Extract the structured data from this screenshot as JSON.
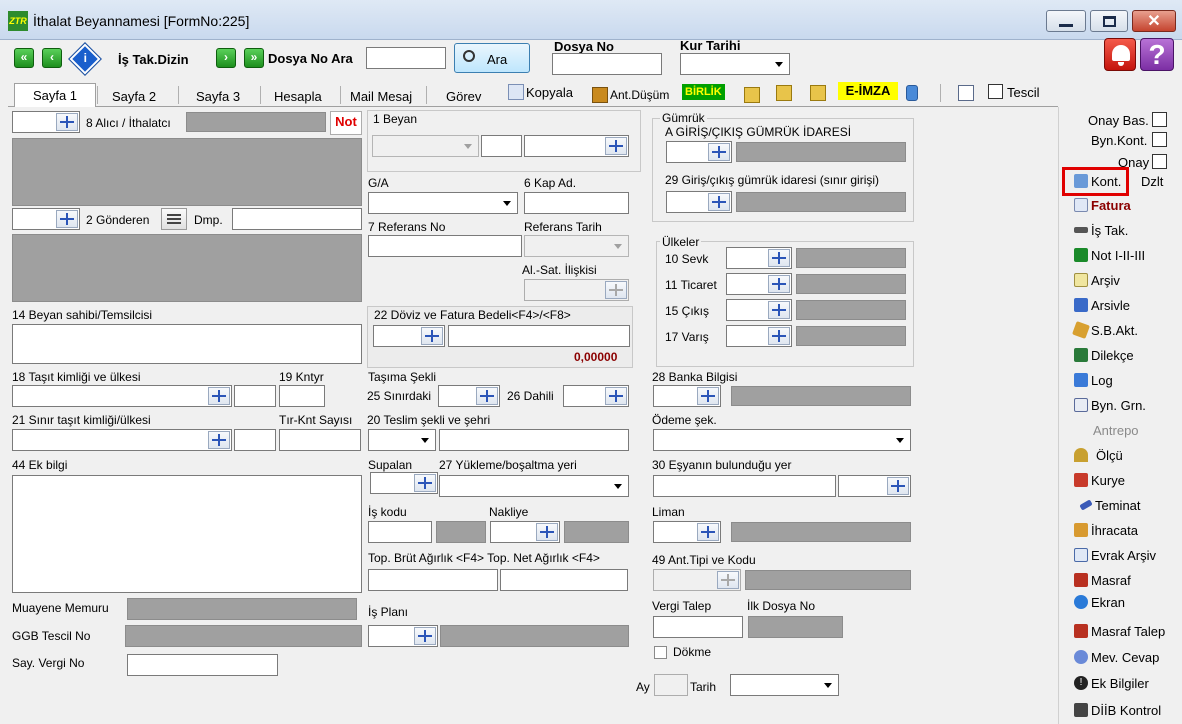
{
  "window": {
    "title": "İthalat Beyannamesi [FormNo:225]",
    "app_icon_text": "ZTR"
  },
  "toolbar": {
    "is_tak_dizin": "İş Tak.Dizin",
    "dosya_no_ara": "Dosya No Ara",
    "ara_button": "Ara",
    "dosya_no_label": "Dosya No",
    "kur_tarihi_label": "Kur Tarihi",
    "help_glyph": "?"
  },
  "tabs": [
    {
      "label": "Sayfa 1"
    },
    {
      "label": "Sayfa 2"
    },
    {
      "label": "Sayfa 3"
    },
    {
      "label": "Hesapla"
    },
    {
      "label": "Mail Mesaj"
    },
    {
      "label": "Görev"
    }
  ],
  "tab_tools": {
    "kopyala": "Kopyala",
    "ant_dusum": "Ant.Düşüm",
    "birlik": "BİRLİK",
    "e_imza": "E-İMZA",
    "tescil": "Tescil"
  },
  "form": {
    "alici": "8 Alıcı / İthalatcı",
    "not_badge": "Not",
    "gonderen": "2 Gönderen",
    "dmp": "Dmp.",
    "beyan_sahibi": "14 Beyan sahibi/Temsilcisi",
    "tasit_kimligi": "18 Taşıt kimliği ve ülkesi",
    "kntyr": "19 Kntyr",
    "sinir_tasit": "21 Sınır taşıt kimliği/ülkesi",
    "tir_knt": "Tır-Knt Sayısı",
    "ek_bilgi": "44 Ek bilgi",
    "muayene": "Muayene Memuru",
    "ggb_tescil": "GGB Tescil No",
    "say_vergi": "Say. Vergi No",
    "beyan": "1 Beyan",
    "ga": "G/A",
    "kap_ad": "6 Kap Ad.",
    "referans_no": "7 Referans No",
    "referans_tarih": "Referans Tarih",
    "al_sat": "Al.-Sat. İlişkisi",
    "doviz": "22 Döviz ve Fatura Bedeli<F4>/<F8>",
    "doviz_value": "0,00000",
    "tasima_sekli": "Taşıma Şekli",
    "sinirdaki": "25 Sınırdaki",
    "dahili": "26 Dahili",
    "teslim": "20 Teslim şekli ve şehri",
    "supalan": "Supalan",
    "yukleme": "27 Yükleme/boşaltma yeri",
    "is_kodu": "İş kodu",
    "nakliye": "Nakliye",
    "brut_net": "Top. Brüt Ağırlık <F4> Top. Net Ağırlık <F4>",
    "is_plani": "İş Planı",
    "gumruk": "Gümrük",
    "giris_cikis_idare": "A GİRİŞ/ÇIKIŞ GÜMRÜK İDARESİ",
    "giris_cikis_29": "29 Giriş/çıkış gümrük idaresi (sınır girişi)",
    "ulkeler": "Ülkeler",
    "sevk": "10 Sevk",
    "ticaret": "11 Ticaret",
    "cikis": "15 Çıkış",
    "varis": "17 Varış",
    "banka": "28 Banka Bilgisi",
    "odeme": "Ödeme şek.",
    "esyanin": "30 Eşyanın bulunduğu yer",
    "liman": "Liman",
    "ant_tipi": "49 Ant.Tipi ve Kodu",
    "vergi_talep": "Vergi Talep",
    "ilk_dosya": "İlk Dosya No",
    "dokme": "Dökme",
    "ay": "Ay",
    "tarih": "Tarih"
  },
  "side": {
    "onay_bas": "Onay Bas.",
    "byn_kont": "Byn.Kont.",
    "onay": "Onay",
    "items": [
      {
        "label": "Kont."
      },
      {
        "label": "Dzlt"
      },
      {
        "label": "Fatura"
      },
      {
        "label": "İş Tak."
      },
      {
        "label": "Not I-II-III"
      },
      {
        "label": "Arşiv"
      },
      {
        "label": "Arsivle"
      },
      {
        "label": "S.B.Akt."
      },
      {
        "label": "Dilekçe"
      },
      {
        "label": "Log"
      },
      {
        "label": "Byn. Grn."
      },
      {
        "label": "Antrepo"
      },
      {
        "label": "Ölçü"
      },
      {
        "label": "Kurye"
      },
      {
        "label": "Teminat"
      },
      {
        "label": "İhracata"
      },
      {
        "label": "Evrak Arşiv"
      },
      {
        "label": "Masraf"
      },
      {
        "label": "Ekran"
      },
      {
        "label": "Masraf Talep"
      },
      {
        "label": "Mev. Cevap"
      },
      {
        "label": "Ek Bilgiler"
      },
      {
        "label": "DİİB Kontrol"
      }
    ]
  },
  "colors": {
    "accent_red": "#e00000",
    "dark_red": "#8b0000",
    "field_gray": "#a0a0a0"
  }
}
